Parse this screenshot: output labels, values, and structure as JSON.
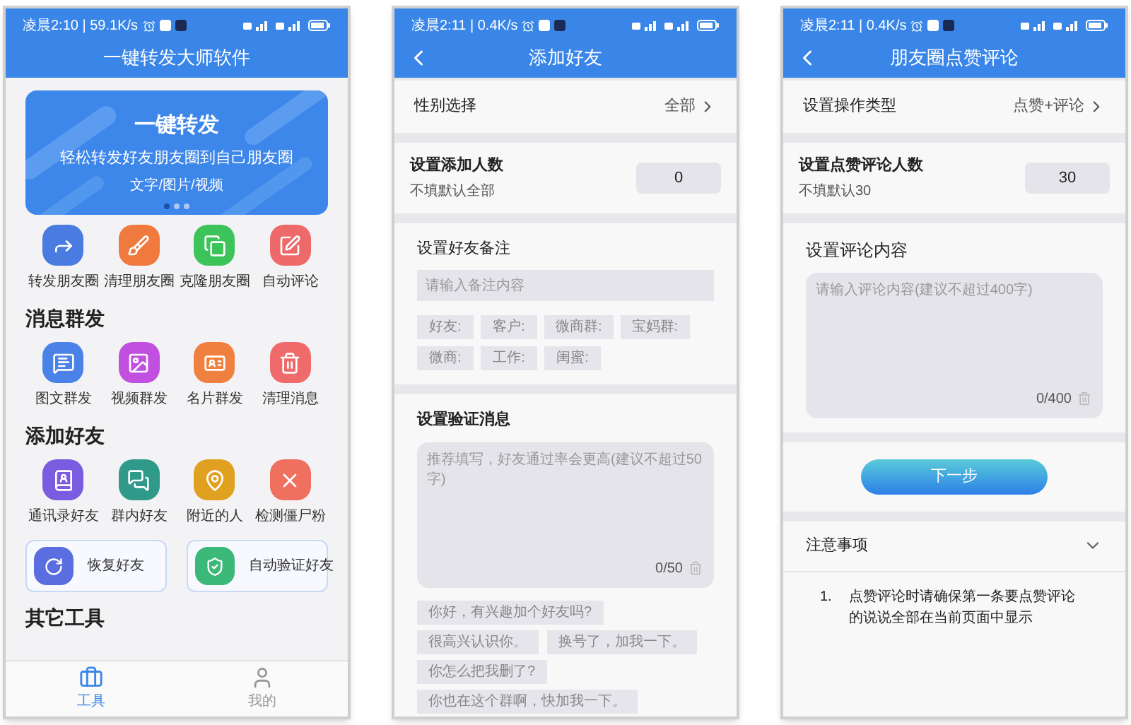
{
  "phones": [
    {
      "kind": "tools",
      "status": "凌晨2:10 | 59.1K/s",
      "title": "一键转发大师软件",
      "banner": {
        "title": "一键转发",
        "subtitle": "轻松转发好友朋友圈到自己朋友圈",
        "note": "文字/图片/视频",
        "dots": [
          {
            "selected": true
          },
          {
            "selected": false
          },
          {
            "selected": false
          }
        ]
      },
      "sections": [
        {
          "tools": [
            {
              "label": "转发朋友圈",
              "color": "#4a7be0"
            },
            {
              "label": "清理朋友圈",
              "color": "#f07a3e"
            },
            {
              "label": "克隆朋友圈",
              "color": "#3cc45a"
            },
            {
              "label": "自动评论",
              "color": "#ee6a6a"
            }
          ]
        },
        {
          "heading": "消息群发",
          "tools": [
            {
              "label": "图文群发",
              "color": "#4a82e8"
            },
            {
              "label": "视频群发",
              "color": "#c14fe0"
            },
            {
              "label": "名片群发",
              "color": "#f08040"
            },
            {
              "label": "清理消息",
              "color": "#ef6a6a"
            }
          ]
        },
        {
          "heading": "添加好友",
          "tools": [
            {
              "label": "通讯录好友",
              "color": "#7a5ce0"
            },
            {
              "label": "群内好友",
              "color": "#2f9a8a"
            },
            {
              "label": "附近的人",
              "color": "#e0a020"
            },
            {
              "label": "检测僵尸粉",
              "color": "#f07060"
            }
          ],
          "cards": [
            {
              "label": "恢复好友",
              "color": "#5a6ee0"
            },
            {
              "label": "自动验证好友",
              "color": "#3cb878"
            }
          ]
        },
        {
          "heading": "其它工具"
        }
      ],
      "tabbar": [
        {
          "label": "工具",
          "selected": true
        },
        {
          "label": "我的",
          "selected": false
        }
      ]
    },
    {
      "kind": "form",
      "status": "凌晨2:11 | 0.4K/s",
      "title": "添加好友",
      "sections": [
        {
          "kind": "select",
          "label": "性别选择",
          "value": "全部"
        },
        {
          "kind": "number",
          "label": "设置添加人数",
          "hint": "不填默认全部",
          "value": "0"
        },
        {
          "kind": "input",
          "label": "设置好友备注",
          "placeholder": "请输入备注内容",
          "tags": [
            "好友:",
            "客户:",
            "微商群:",
            "宝妈群:",
            "微商:",
            "工作:",
            "闺蜜:"
          ]
        },
        {
          "kind": "textarea",
          "label": "设置验证消息",
          "placeholder": "推荐填写，好友通过率会更高(建议不超过50字)",
          "counter": "0/50",
          "tags": [
            "你好，有兴趣加个好友吗?",
            "很高兴认识你。",
            "换号了，加我一下。",
            "你怎么把我删了?",
            "你也在这个群啊，快加我一下。"
          ]
        }
      ]
    },
    {
      "kind": "form",
      "status": "凌晨2:11 | 0.4K/s",
      "title": "朋友圈点赞评论",
      "sections": [
        {
          "kind": "select",
          "label": "设置操作类型",
          "value": "点赞+评论"
        },
        {
          "kind": "number",
          "label": "设置点赞评论人数",
          "hint": "不填默认30",
          "value": "30"
        },
        {
          "kind": "textarea",
          "label": "设置评论内容",
          "placeholder": "请输入评论内容(建议不超过400字)",
          "counter": "0/400"
        },
        {
          "kind": "button",
          "label": "下一步"
        },
        {
          "kind": "notes",
          "label": "注意事项",
          "expanded": true,
          "items": [
            {
              "number": "1.",
              "text": "点赞评论时请确保第一条要点赞评论的说说全部在当前页面中显示"
            }
          ]
        }
      ]
    }
  ]
}
